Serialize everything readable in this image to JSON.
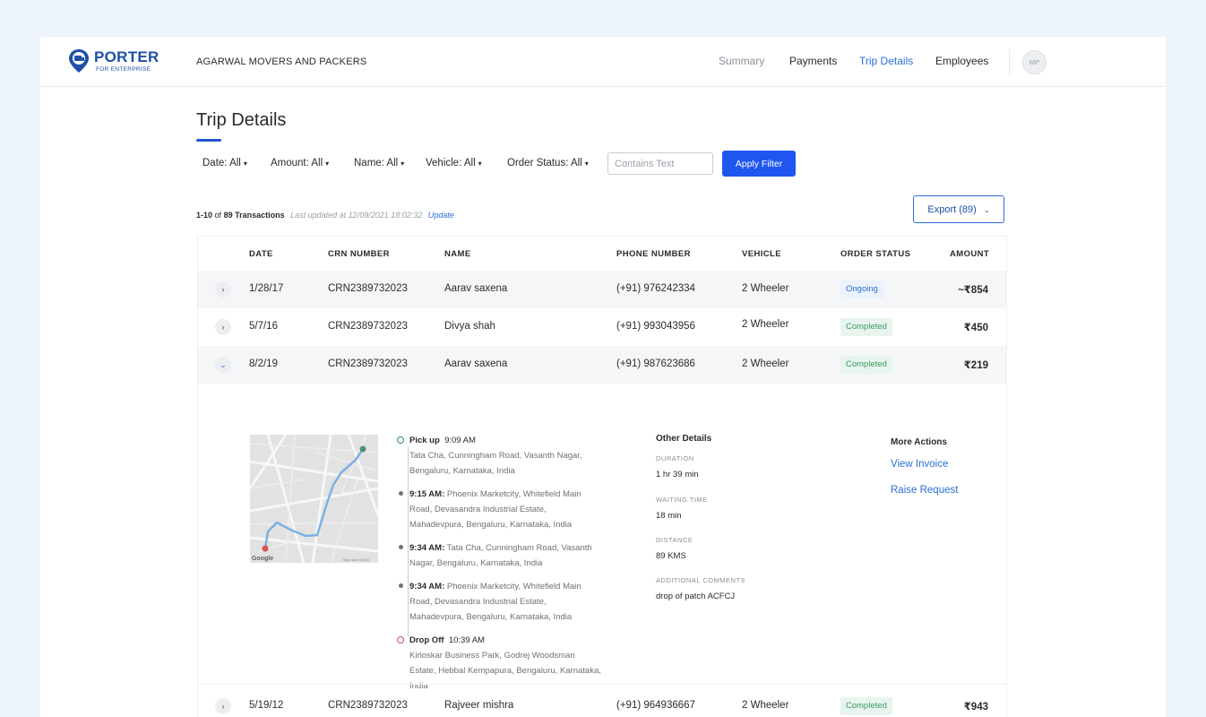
{
  "brand": {
    "name": "PORTER",
    "subtitle": "FOR ENTERPRISE",
    "color": "#1f4fa8"
  },
  "company": "AGARWAL MOVERS AND PACKERS",
  "nav": [
    {
      "label": "Summary"
    },
    {
      "label": "Payments"
    },
    {
      "label": "Trip Details",
      "active": true
    },
    {
      "label": "Employees"
    }
  ],
  "user": {
    "initials": "MP"
  },
  "page": {
    "title": "Trip Details"
  },
  "filters": [
    {
      "label": "Date:",
      "value": "All"
    },
    {
      "label": "Amount:",
      "value": "All"
    },
    {
      "label": "Name:",
      "value": "All"
    },
    {
      "label": "Vehicle:",
      "value": "All"
    },
    {
      "label": "Order Status:",
      "value": "All"
    }
  ],
  "search": {
    "placeholder": "Contains Text",
    "value": ""
  },
  "apply_button": "Apply Filter",
  "summary": {
    "range": "1-10",
    "of_word": "of",
    "total": "89 Transactions",
    "updated": "Last updated at 12/09/2021 18:02:32",
    "update_link": "Update"
  },
  "export_button": "Export (89)",
  "table": {
    "columns": [
      "DATE",
      "CRN NUMBER",
      "NAME",
      "PHONE NUMBER",
      "VEHICLE",
      "ORDER STATUS",
      "AMOUNT"
    ],
    "rows": [
      {
        "date": "1/28/17",
        "crn": "CRN2389732023",
        "name": "Aarav saxena",
        "phone": "(+91) 976242334",
        "vehicle": "2 Wheeler",
        "status": "Ongoing",
        "amount": "~₹854"
      },
      {
        "date": "5/7/16",
        "crn": "CRN2389732023",
        "name": "Divya shah",
        "phone": "(+91) 993043956",
        "vehicle": "2 Wheeler",
        "status": "Completed",
        "amount": "₹450"
      },
      {
        "date": "8/2/19",
        "crn": "CRN2389732023",
        "name": "Aarav saxena",
        "phone": "(+91) 987623686",
        "vehicle": "2 Wheeler",
        "status": "Completed",
        "amount": "₹219"
      },
      {
        "date": "5/19/12",
        "crn": "CRN2389732023",
        "name": "Rajveer mishra",
        "phone": "(+91) 964936667",
        "vehicle": "2 Wheeler",
        "status": "Completed",
        "amount": "₹943"
      }
    ]
  },
  "expanded": {
    "map": {
      "watermark": "Google",
      "credit": "Map data ©2020"
    },
    "timeline": [
      {
        "title": "Pick up",
        "time": "9:09 AM",
        "address": "Tata Cha, Cunningham Road, Vasanth Nagar, Bengaluru, Karnataka, India"
      },
      {
        "time": "9:15 AM:",
        "address": "Phoenix Marketcity, Whitefield Main Road, Devasandra Industrial Estate, Mahadevpura, Bengaluru, Karnataka, India"
      },
      {
        "time": "9:34 AM:",
        "address": "Tata Cha, Cunningham Road, Vasanth Nagar, Bengaluru, Karnataka, India"
      },
      {
        "time": "9:34 AM:",
        "address": "Phoenix Marketcity, Whitefield Main Road, Devasandra Industrial Estate, Mahadevpura, Bengaluru, Karnataka, India"
      },
      {
        "title": "Drop Off",
        "time": "10:39 AM",
        "address": "Kirloskar Business Park, Godrej Woodsman Estate, Hebbal Kempapura, Bengaluru, Karnataka, India"
      }
    ],
    "other_details": {
      "title": "Other Details",
      "duration_label": "DURATION",
      "duration": "1 hr 39 min",
      "waiting_label": "WAITING TIME",
      "waiting": "18 min",
      "distance_label": "DISTANCE",
      "distance": "89 KMS",
      "comments_label": "ADDITIONAL COMMENTS",
      "comments": "drop of patch ACFCJ"
    },
    "more_actions": {
      "title": "More Actions",
      "view_invoice": "View Invoice",
      "raise_request": "Raise Request"
    }
  },
  "colors": {
    "accent": "#1f56f0",
    "link": "#2a6fd6",
    "ongoing": "#2a6fd6",
    "completed": "#3c9a63",
    "background": "#eef4fb"
  }
}
